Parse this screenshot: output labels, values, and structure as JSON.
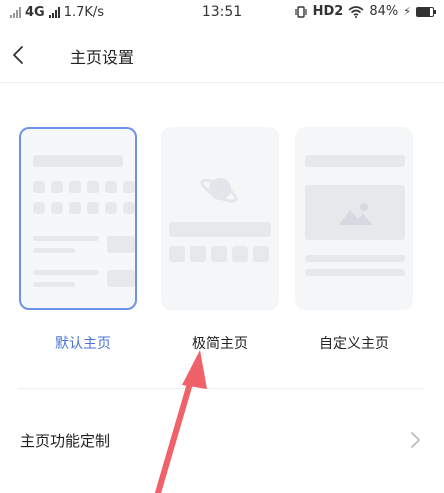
{
  "status_bar": {
    "network": "4G",
    "speed": "1.7K/s",
    "time": "13:51",
    "hd": "HD2",
    "battery": "84%",
    "battery_level": 0.84
  },
  "header": {
    "title": "主页设置"
  },
  "home_options": [
    {
      "label": "默认主页",
      "selected": true
    },
    {
      "label": "极简主页",
      "selected": false
    },
    {
      "label": "自定义主页",
      "selected": false
    }
  ],
  "settings_row": {
    "label": "主页功能定制"
  },
  "colors": {
    "accent": "#4a74d9",
    "arrow": "#f0626a"
  }
}
